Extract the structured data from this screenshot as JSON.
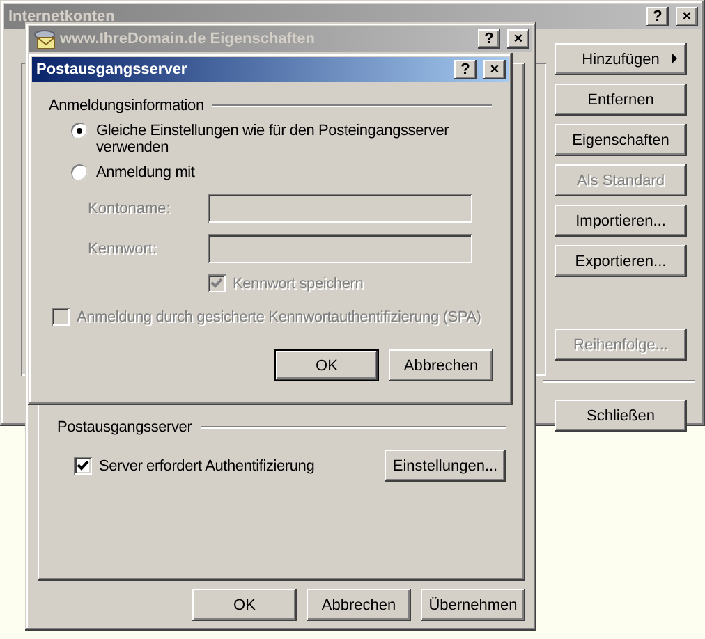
{
  "accounts_window": {
    "title": "Internetkonten",
    "active": false,
    "title_buttons": [
      "?",
      "×"
    ],
    "buttons": [
      {
        "label": "Hinzufügen",
        "disabled": false,
        "arrow": true
      },
      {
        "label": "Entfernen",
        "disabled": false,
        "arrow": false
      },
      {
        "label": "Eigenschaften",
        "disabled": false,
        "arrow": false
      },
      {
        "label": "Als Standard",
        "disabled": true,
        "arrow": false
      },
      {
        "label": "Importieren...",
        "disabled": false,
        "arrow": false
      },
      {
        "label": "Exportieren...",
        "disabled": false,
        "arrow": false
      },
      {
        "label": "Reihenfolge...",
        "disabled": true,
        "arrow": false
      }
    ],
    "close_button": "Schließen"
  },
  "properties_window": {
    "title": "www.IhreDomain.de Eigenschaften",
    "active": false,
    "title_buttons": [
      "?",
      "×"
    ],
    "group": {
      "title": "Postausgangsserver",
      "checkbox": {
        "label": "Server erfordert Authentifizierung",
        "checked": true,
        "disabled": false
      },
      "button": "Einstellungen..."
    },
    "buttons": [
      {
        "label": "OK",
        "default": false
      },
      {
        "label": "Abbrechen",
        "default": false
      },
      {
        "label": "Übernehmen",
        "default": false
      }
    ]
  },
  "outgoing_dialog": {
    "title": "Postausgangsserver",
    "active": true,
    "title_buttons": [
      "?",
      "×"
    ],
    "group_title": "Anmeldungsinformation",
    "options": [
      {
        "label": "Gleiche Einstellungen wie für den Posteingangsserver verwenden",
        "selected": true
      },
      {
        "label": "Anmeldung mit",
        "selected": false
      }
    ],
    "fields": [
      {
        "label": "Kontoname:",
        "disabled": true
      },
      {
        "label": "Kennwort:",
        "disabled": true
      }
    ],
    "save_password": {
      "label": "Kennwort speichern",
      "checked": true,
      "disabled": true
    },
    "spa": {
      "label": "Anmeldung durch gesicherte Kennwortauthentifizierung (SPA)",
      "checked": false,
      "disabled": true
    },
    "buttons": [
      {
        "label": "OK",
        "default": true
      },
      {
        "label": "Abbrechen",
        "default": false
      }
    ]
  }
}
